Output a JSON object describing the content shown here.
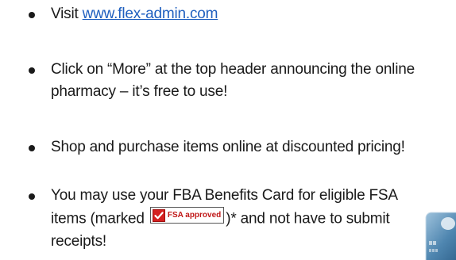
{
  "bullets": [
    {
      "prefix": "Visit ",
      "link_text": "www.flex-admin.com"
    },
    {
      "text": "Click on “More” at the top header announcing the online pharmacy – it’s free to use!"
    },
    {
      "text": "Shop and purchase items online at discounted pricing!"
    },
    {
      "text_before_badge": "You may use your FBA Benefits Card for eligible FSA items (marked ",
      "text_after_badge": ")* and not have to submit receipts!"
    }
  ],
  "fsa_badge": {
    "label": "FSA approved",
    "icon": "checkmark-icon",
    "color": "#c01818"
  },
  "link_color": "#1f5fbf",
  "card_image": {
    "icon": "credit-card-icon"
  }
}
